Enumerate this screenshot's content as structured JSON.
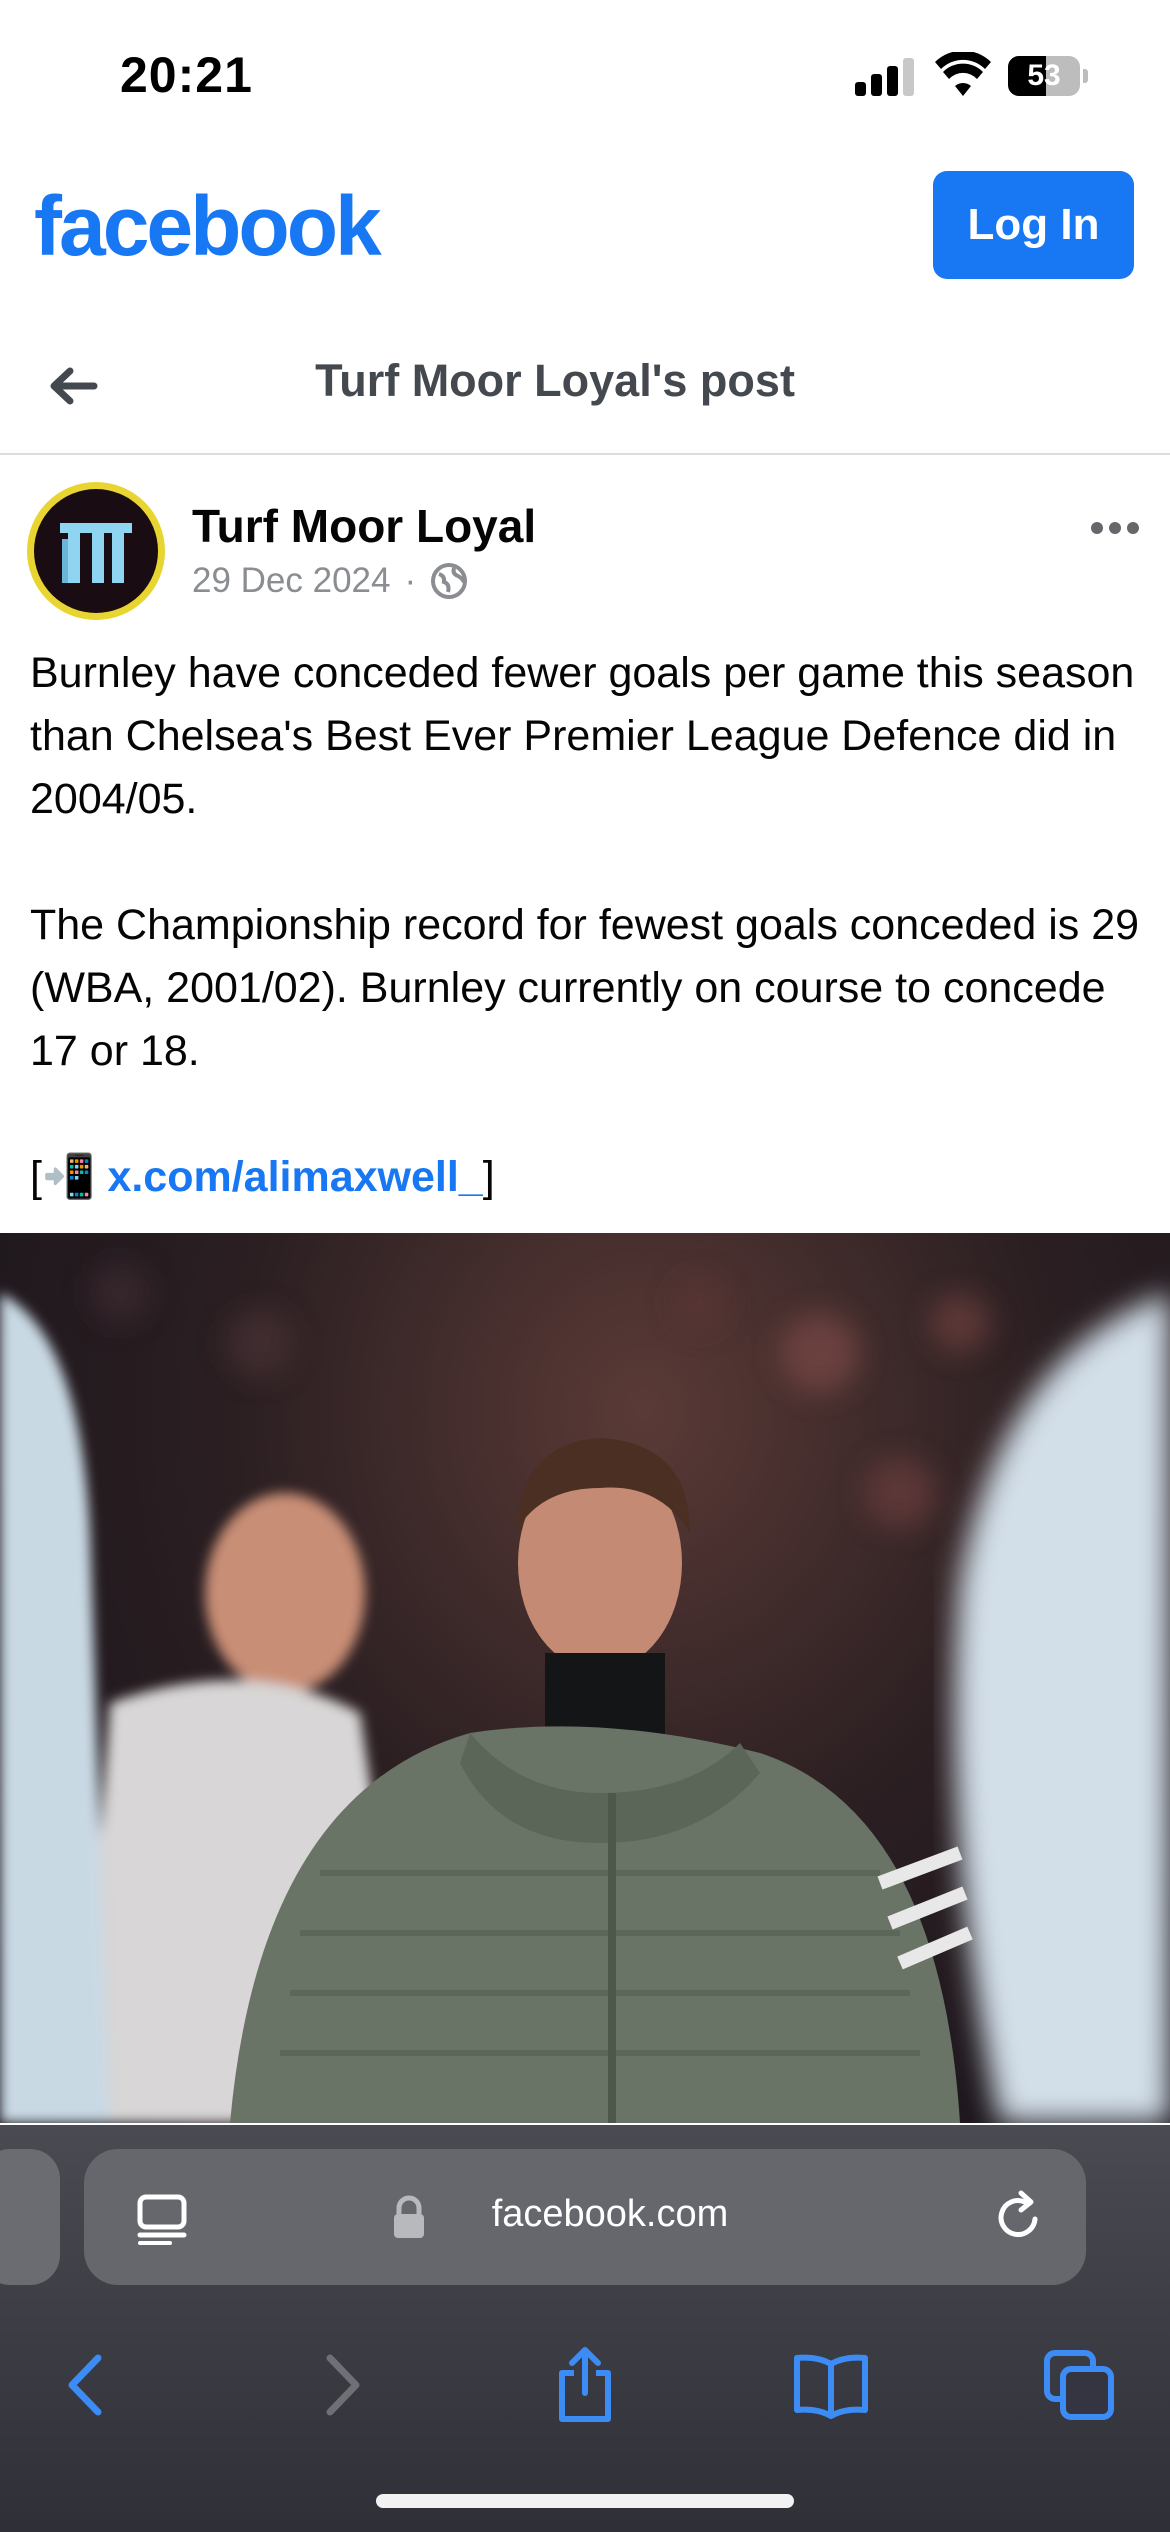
{
  "status_bar": {
    "time": "20:21",
    "battery_level": "53",
    "icons": [
      "cellular-signal-icon",
      "wifi-icon",
      "battery-icon"
    ]
  },
  "header": {
    "logo": "facebook",
    "login_label": "Log In",
    "brand_color": "#1877f2"
  },
  "post_nav": {
    "title": "Turf Moor Loyal's post",
    "back_icon": "arrow-left-icon"
  },
  "post": {
    "author": "Turf Moor Loyal",
    "date": "29 Dec 2024",
    "separator": "·",
    "audience_icon": "globe-icon",
    "paragraph_1": "Burnley have conceded fewer goals per game this season than Chelsea's Best Ever Premier League Defence did in 2004/05.",
    "paragraph_2": "The Championship record for fewest goals conceded is 29 (WBA, 2001/02). Burnley currently on course to concede 17 or 18.",
    "source_prefix": "[📲 ",
    "source_link": "x.com/alimaxwell_",
    "source_suffix": "]"
  },
  "browser": {
    "url": "facebook.com",
    "icons": [
      "reader-icon",
      "lock-icon",
      "reload-icon",
      "back-icon",
      "forward-icon",
      "share-icon",
      "bookmarks-icon",
      "tabs-icon"
    ]
  }
}
